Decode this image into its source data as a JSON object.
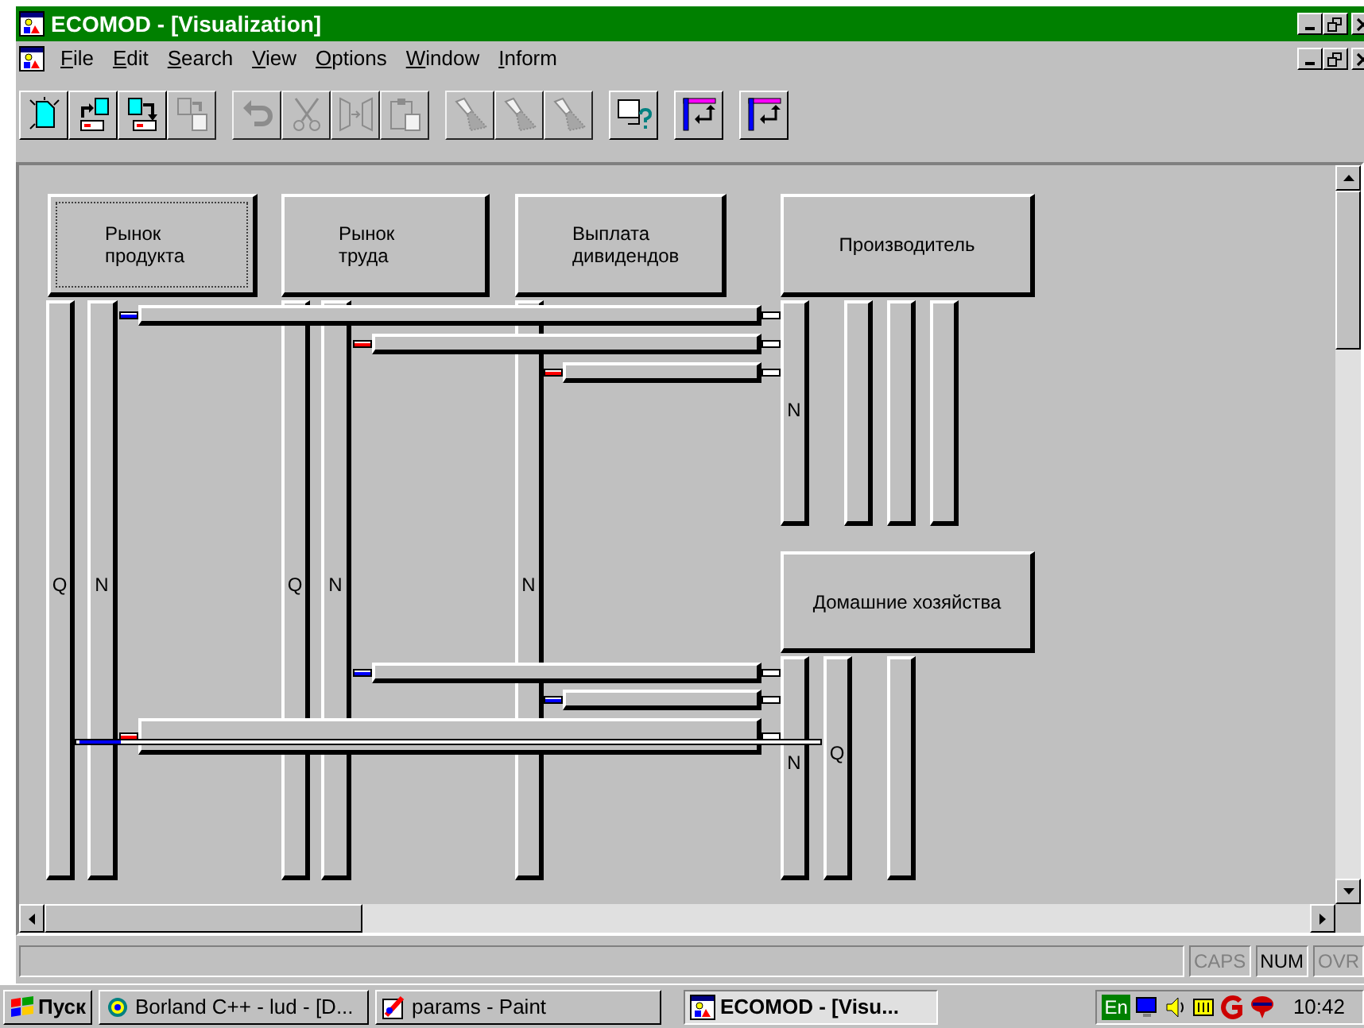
{
  "window": {
    "title": "ECOMOD - [Visualization]"
  },
  "menu": [
    "File",
    "Edit",
    "Search",
    "View",
    "Options",
    "Window",
    "Inform"
  ],
  "toolbar": [
    {
      "kind": "new",
      "disabled": false
    },
    {
      "kind": "open",
      "disabled": false
    },
    {
      "kind": "save",
      "disabled": false
    },
    {
      "kind": "export",
      "disabled": true
    },
    {
      "kind": "undo",
      "disabled": true
    },
    {
      "kind": "cut",
      "disabled": true
    },
    {
      "kind": "move",
      "disabled": true
    },
    {
      "kind": "paste",
      "disabled": true
    },
    {
      "kind": "lamp",
      "disabled": true
    },
    {
      "kind": "lamp",
      "disabled": true
    },
    {
      "kind": "lamp",
      "disabled": true
    },
    {
      "kind": "help",
      "disabled": false
    },
    {
      "kind": "route",
      "disabled": false
    },
    {
      "kind": "route",
      "disabled": false
    }
  ],
  "diagram": {
    "blocks": [
      {
        "lines": [
          "Рынок",
          "продукта"
        ],
        "selected": true
      },
      {
        "lines": [
          "Рынок",
          "труда"
        ],
        "selected": false
      },
      {
        "lines": [
          "Выплата",
          "дивидендов"
        ],
        "selected": false
      },
      {
        "lines": [
          "Производитель"
        ],
        "selected": false
      },
      {
        "lines": [
          "Домашние хозяйства"
        ],
        "selected": false
      }
    ],
    "bar_labels": [
      "Q",
      "N",
      "Q",
      "N",
      "N",
      "N",
      "N",
      "Q"
    ],
    "flows": [
      {
        "color": "#0000ff"
      },
      {
        "color": "#ff0000"
      },
      {
        "color": "#ff0000"
      },
      {
        "color": "#0000ff"
      },
      {
        "color": "#0000ff"
      },
      {
        "color": "#ff0000"
      },
      {
        "color": "#0000ff"
      }
    ]
  },
  "status_bar": [
    {
      "text": "CAPS",
      "on": false
    },
    {
      "text": "NUM",
      "on": true
    },
    {
      "text": "OVR",
      "on": false
    }
  ],
  "taskbar": {
    "start": "Пуск",
    "tasks": [
      {
        "label": "Borland C++ - lud - [D...",
        "selected": false,
        "kind": "borland"
      },
      {
        "label": "params - Paint",
        "selected": false,
        "kind": "paint"
      },
      {
        "label": "ECOMOD - [Visu...",
        "selected": true,
        "kind": "ecomod"
      }
    ],
    "language": "En",
    "clock": "10:42"
  }
}
